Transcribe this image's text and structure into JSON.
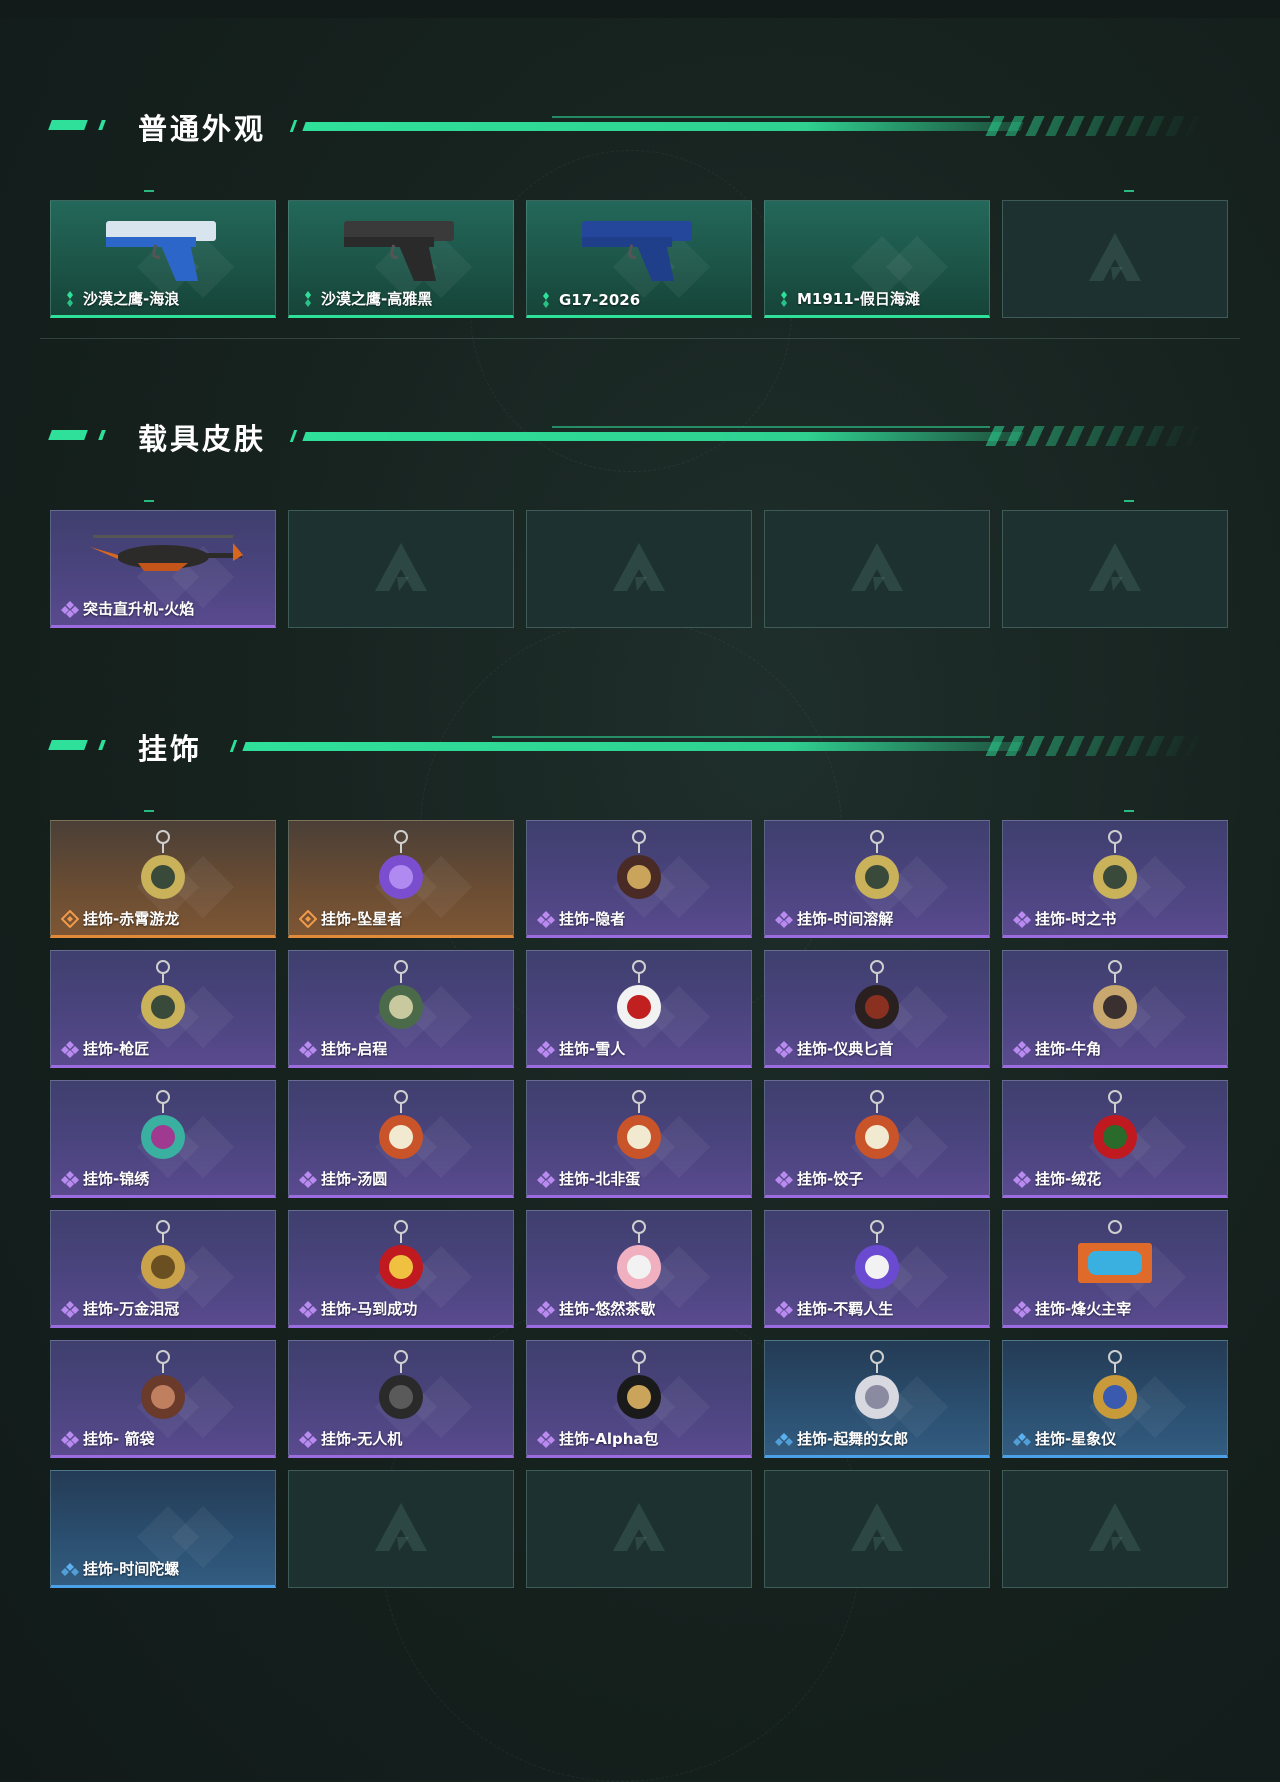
{
  "sections": [
    {
      "title": "普通外观",
      "items": [
        {
          "label": "沙漠之鹰-海浪",
          "rarity": "green",
          "art": "deagle-wave"
        },
        {
          "label": "沙漠之鹰-高雅黑",
          "rarity": "green",
          "art": "deagle-black"
        },
        {
          "label": "G17-2026",
          "rarity": "green",
          "art": "g17"
        },
        {
          "label": "M1911-假日海滩",
          "rarity": "green",
          "art": "none"
        },
        {
          "label": "",
          "rarity": "empty",
          "art": "none"
        }
      ]
    },
    {
      "title": "载具皮肤",
      "items": [
        {
          "label": "突击直升机-火焰",
          "rarity": "purple",
          "art": "helicopter"
        },
        {
          "label": "",
          "rarity": "empty",
          "art": "none"
        },
        {
          "label": "",
          "rarity": "empty",
          "art": "none"
        },
        {
          "label": "",
          "rarity": "empty",
          "art": "none"
        },
        {
          "label": "",
          "rarity": "empty",
          "art": "none"
        }
      ]
    },
    {
      "title": "挂饰",
      "items": [
        {
          "label": "挂饰-赤霄游龙",
          "rarity": "orange",
          "art": "charm"
        },
        {
          "label": "挂饰-坠星者",
          "rarity": "orange",
          "art": "charm-crystal"
        },
        {
          "label": "挂饰-隐者",
          "rarity": "purple",
          "art": "charm-card"
        },
        {
          "label": "挂饰-时间溶解",
          "rarity": "purple",
          "art": "charm"
        },
        {
          "label": "挂饰-时之书",
          "rarity": "purple",
          "art": "charm"
        },
        {
          "label": "挂饰-枪匠",
          "rarity": "purple",
          "art": "charm"
        },
        {
          "label": "挂饰-启程",
          "rarity": "purple",
          "art": "charm-round"
        },
        {
          "label": "挂饰-雪人",
          "rarity": "purple",
          "art": "charm-snowman"
        },
        {
          "label": "挂饰-仪典匕首",
          "rarity": "purple",
          "art": "charm-knife"
        },
        {
          "label": "挂饰-牛角",
          "rarity": "purple",
          "art": "charm-horn"
        },
        {
          "label": "挂饰-锦绣",
          "rarity": "purple",
          "art": "charm-butterfly"
        },
        {
          "label": "挂饰-汤圆",
          "rarity": "purple",
          "art": "charm-bowl"
        },
        {
          "label": "挂饰-北非蛋",
          "rarity": "purple",
          "art": "charm-bowl"
        },
        {
          "label": "挂饰-饺子",
          "rarity": "purple",
          "art": "charm-bowl"
        },
        {
          "label": "挂饰-绒花",
          "rarity": "purple",
          "art": "charm-rose"
        },
        {
          "label": "挂饰-万金泪冠",
          "rarity": "purple",
          "art": "charm-crown"
        },
        {
          "label": "挂饰-马到成功",
          "rarity": "purple",
          "art": "charm-horse"
        },
        {
          "label": "挂饰-悠然茶歇",
          "rarity": "purple",
          "art": "charm-cake"
        },
        {
          "label": "挂饰-不羁人生",
          "rarity": "purple",
          "art": "charm-shoe"
        },
        {
          "label": "挂饰-烽火主宰",
          "rarity": "purple",
          "art": "charm-sign"
        },
        {
          "label": "挂饰- 箭袋",
          "rarity": "purple",
          "art": "charm-quiver"
        },
        {
          "label": "挂饰-无人机",
          "rarity": "purple",
          "art": "charm-drone"
        },
        {
          "label": "挂饰-Alpha包",
          "rarity": "purple",
          "art": "charm-bag"
        },
        {
          "label": "挂饰-起舞的女郎",
          "rarity": "blue",
          "art": "charm-dancer"
        },
        {
          "label": "挂饰-星象仪",
          "rarity": "blue",
          "art": "charm-orb"
        },
        {
          "label": "挂饰-时间陀螺",
          "rarity": "blue",
          "art": "none"
        },
        {
          "label": "",
          "rarity": "empty",
          "art": "none"
        },
        {
          "label": "",
          "rarity": "empty",
          "art": "none"
        },
        {
          "label": "",
          "rarity": "empty",
          "art": "none"
        },
        {
          "label": "",
          "rarity": "empty",
          "art": "none"
        }
      ]
    }
  ],
  "colors": {
    "accent": "#2fe09a",
    "green_rarity": "#2fe09a",
    "purple_rarity": "#9b6be0",
    "orange_rarity": "#e08a3a",
    "blue_rarity": "#4ba0e8",
    "empty_slot": "#1d3230"
  }
}
